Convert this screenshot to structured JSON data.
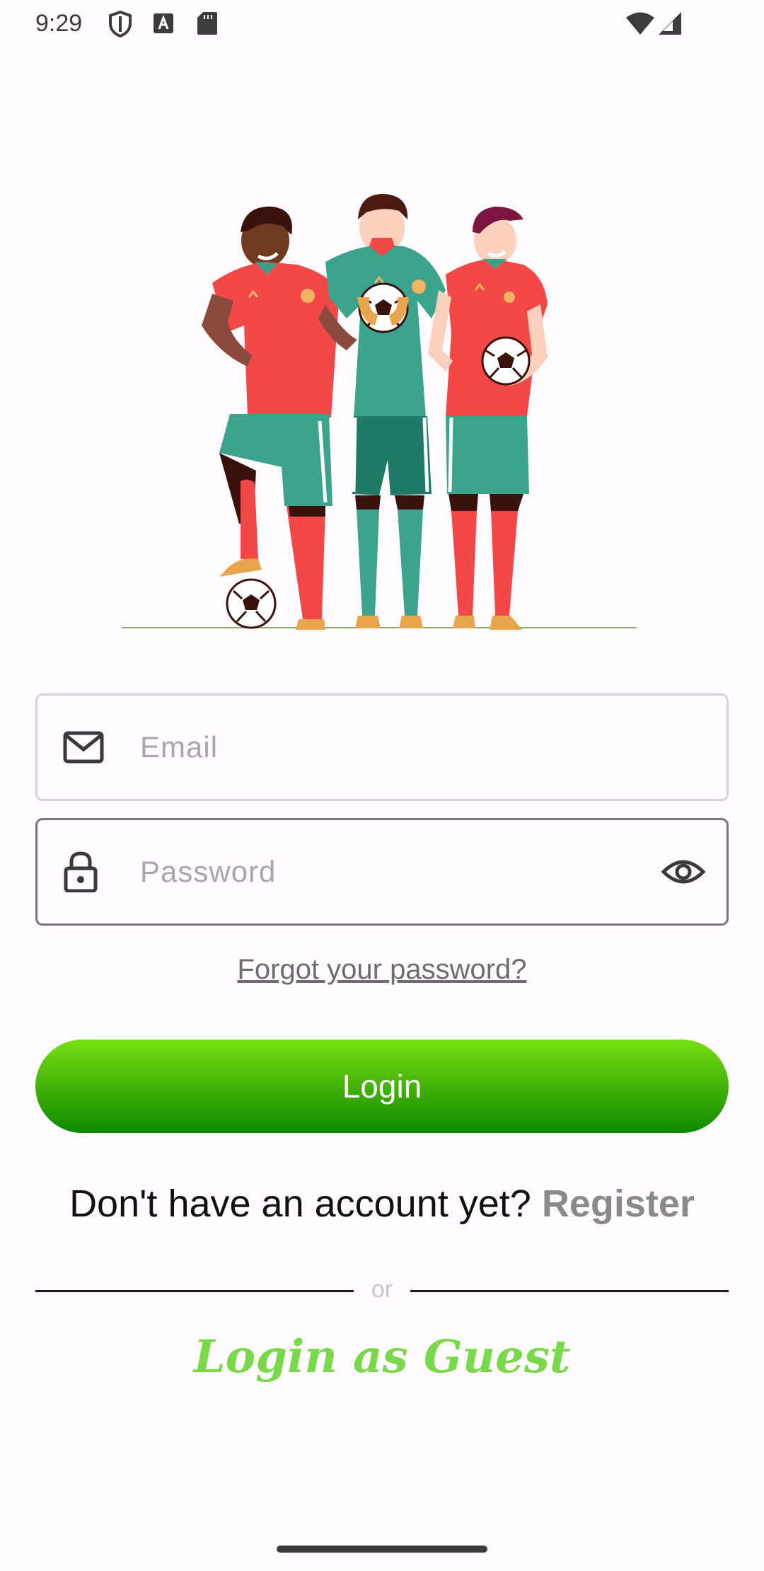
{
  "status_bar": {
    "time": "9:29",
    "icons": [
      "shield-icon",
      "a-text-icon",
      "sd-card-icon",
      "wifi-icon",
      "signal-icon"
    ]
  },
  "hero": {
    "illustration": "three-football-players-illustration"
  },
  "form": {
    "email_placeholder": "Email",
    "password_placeholder": "Password",
    "email_icon": "mail-icon",
    "password_icon": "lock-icon",
    "visibility_icon": "eye-icon",
    "forgot_label": "Forgot your password?",
    "login_label": "Login"
  },
  "register": {
    "prompt": "Don't have an account yet?",
    "link": "Register"
  },
  "divider": {
    "label": "or"
  },
  "guest": {
    "label": "Login as Guest"
  },
  "colors": {
    "login_gradient_top": "#77e012",
    "login_gradient_bottom": "#0d8a00",
    "guest_green": "#79d94a",
    "register_gray": "#8a8a8a",
    "background": "#fffbfe"
  }
}
